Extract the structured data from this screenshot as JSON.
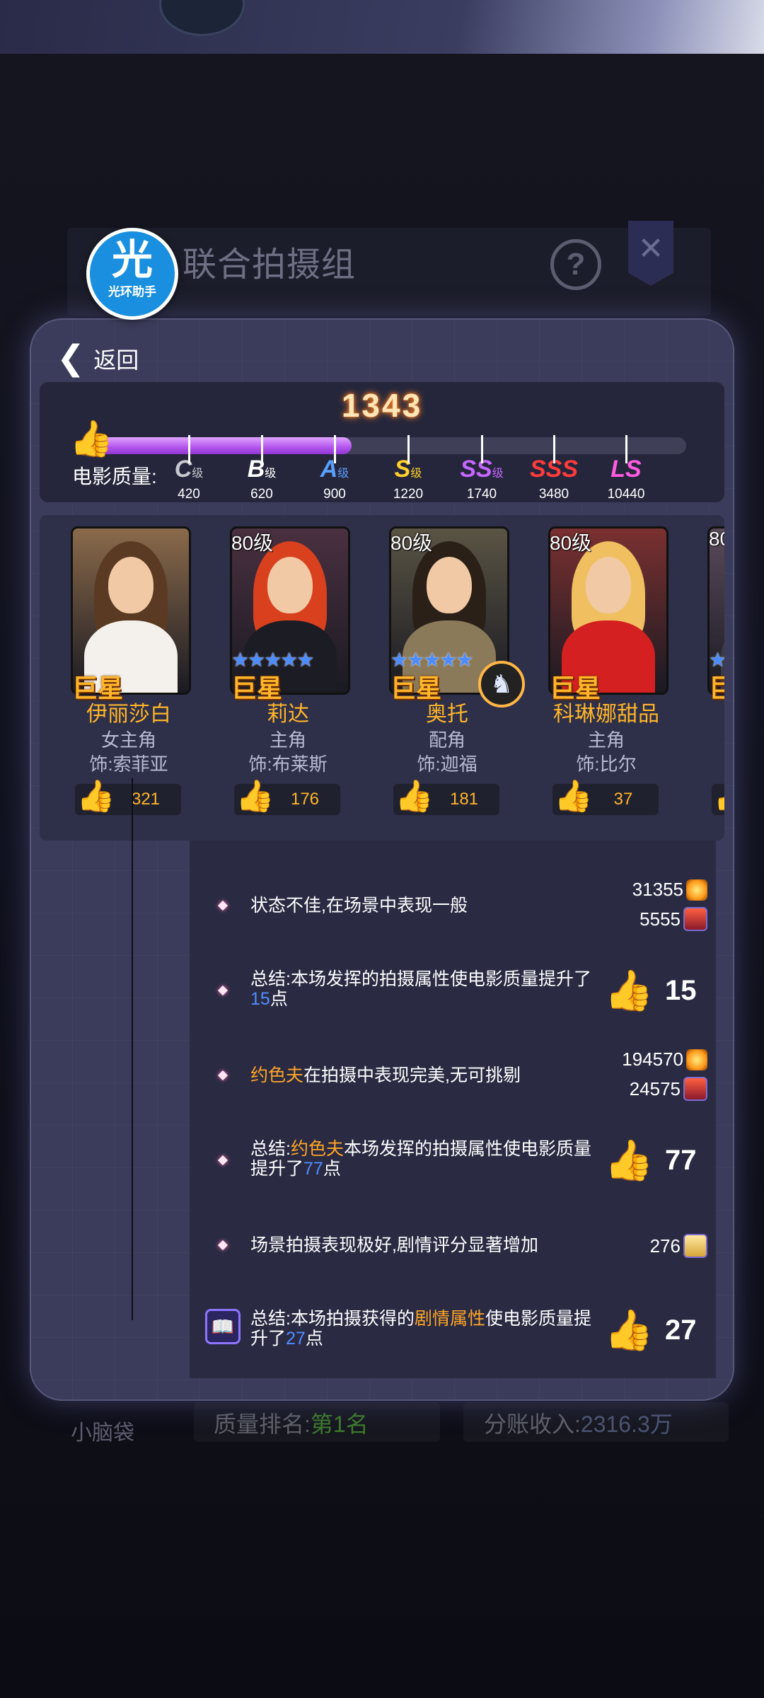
{
  "background": {
    "title": "联合拍摄组",
    "help_icon": "question-icon",
    "close_icon": "close-icon",
    "bottom_label": "小脑袋",
    "rank_label": "质量排名:",
    "rank_value": "第1名",
    "income_label": "分账收入:",
    "income_value": "2316.3万"
  },
  "assistant_badge": {
    "glyph": "光",
    "text": "光环助手"
  },
  "back": {
    "label": "返回",
    "icon": "chevron-left-icon"
  },
  "quality": {
    "score": "1343",
    "label": "电影质量:",
    "progress_fraction": 0.43,
    "grades": [
      {
        "letter": "C",
        "suffix": "级",
        "value": "420",
        "color": "#c8c8d0"
      },
      {
        "letter": "B",
        "suffix": "级",
        "value": "620",
        "color": "#ffffff"
      },
      {
        "letter": "A",
        "suffix": "级",
        "value": "900",
        "color": "#5aa0ff"
      },
      {
        "letter": "S",
        "suffix": "级",
        "value": "1220",
        "color": "#ffd02a"
      },
      {
        "letter": "SS",
        "suffix": "级",
        "value": "1740",
        "color": "#c466ff"
      },
      {
        "letter": "SSS",
        "suffix": "",
        "value": "3480",
        "color": "#ff3b3b"
      },
      {
        "letter": "LS",
        "suffix": "",
        "value": "10440",
        "color": "#ff5ae0"
      }
    ]
  },
  "characters": [
    {
      "level": "",
      "stars": "",
      "tag": "巨星",
      "name": "伊丽莎白",
      "role": "女主角",
      "played_by": "饰:索菲亚",
      "likes": "321",
      "bg": "#8a6a4a",
      "hair": "#5a3a22",
      "body": "#f4f1ec"
    },
    {
      "level": "80级",
      "stars": "★★★★★",
      "tag": "巨星",
      "name": "莉达",
      "role": "主角",
      "played_by": "饰:布莱斯",
      "likes": "176",
      "bg": "#4a3040",
      "hair": "#d8401e",
      "body": "#1c1c24"
    },
    {
      "level": "80级",
      "stars": "★★★★★",
      "tag": "巨星",
      "name": "奥托",
      "role": "配角",
      "played_by": "饰:迦福",
      "likes": "181",
      "bg": "#5a5444",
      "hair": "#2a2018",
      "body": "#8a7a5a"
    },
    {
      "level": "80级",
      "stars": "",
      "tag": "巨星",
      "name": "科琳娜甜品",
      "role": "主角",
      "played_by": "饰:比尔",
      "likes": "37",
      "bg": "#7a3030",
      "hair": "#f0c060",
      "body": "#d42020"
    },
    {
      "level": "80",
      "stars": "★",
      "tag": "巨",
      "name": "",
      "role": "",
      "played_by": "饰",
      "likes": "",
      "bg": "#5a4a5a",
      "hair": "#5a4030",
      "body": "#3a3a4a"
    }
  ],
  "knight_icon": "knight-chess-icon",
  "log": {
    "item1": {
      "text": "状态不佳,在场景中表现一般",
      "res1": "31355",
      "res2": "5555"
    },
    "item2": {
      "text_a": "总结:本场发挥的拍摄属性使电影质量提升了",
      "num": "15",
      "text_b": "点",
      "likes": "15"
    },
    "item3": {
      "name": "约色夫",
      "text": "在拍摄中表现完美,无可挑剔",
      "res1": "194570",
      "res2": "24575"
    },
    "item4": {
      "text_a": "总结:",
      "name": "约色夫",
      "text_b": "本场发挥的拍摄属性使电影质量提升了",
      "num": "77",
      "text_c": "点",
      "likes": "77"
    },
    "item5": {
      "text": "场景拍摄表现极好,剧情评分显著增加",
      "res1": "276"
    },
    "item6": {
      "text_a": "总结:本场拍摄获得的",
      "attr": "剧情属性",
      "text_b": "使电影质量提升了",
      "num": "27",
      "text_c": "点",
      "likes": "27"
    }
  },
  "icons": {
    "sun": "sun-icon",
    "reel": "film-reel-icon",
    "book": "book-icon",
    "like": "thumbs-up-icon"
  }
}
